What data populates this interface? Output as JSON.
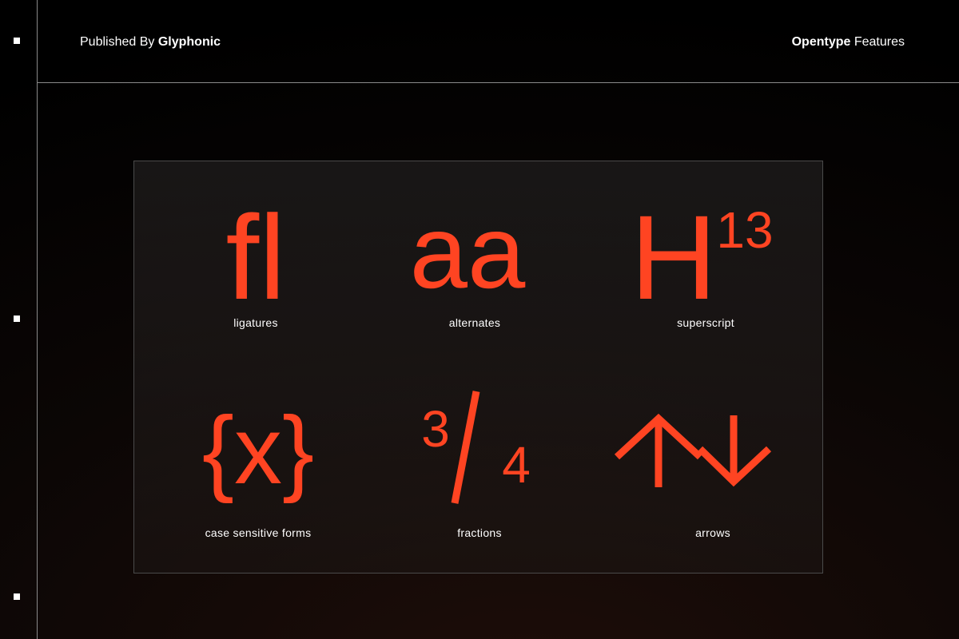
{
  "header": {
    "published_prefix": "Published By",
    "publisher": "Glyphonic",
    "feature_bold": "Opentype",
    "feature_rest": "Features"
  },
  "glyphs": {
    "ligature": "fl",
    "alternates": "aa",
    "superscript_base": "H",
    "superscript_exp": "13",
    "case": "{x}",
    "frac_num": "3",
    "frac_slash": "/",
    "frac_den": "4"
  },
  "features": [
    {
      "label": "ligatures"
    },
    {
      "label": "alternates"
    },
    {
      "label": "superscript"
    },
    {
      "label": "case sensitive forms"
    },
    {
      "label": "fractions"
    },
    {
      "label": "arrows"
    }
  ],
  "colors": {
    "accent": "#ff4422",
    "background": "#000000",
    "text": "#ffffff"
  }
}
